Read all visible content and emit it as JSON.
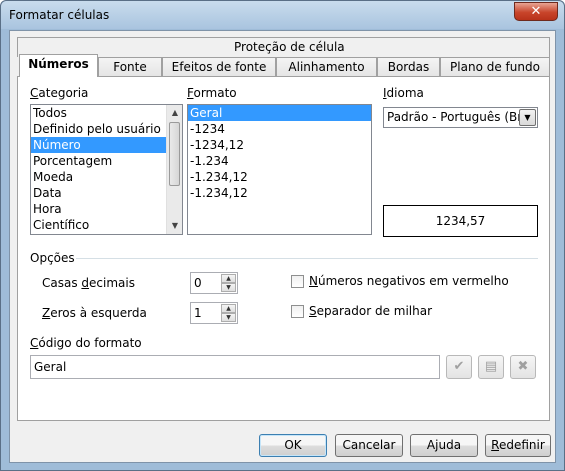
{
  "window": {
    "title": "Formatar células",
    "close_glyph": "✕"
  },
  "tabs_row_top": [
    {
      "label": "Proteção de célula"
    }
  ],
  "tabs_row_bottom": [
    {
      "label": "Números",
      "active": true
    },
    {
      "label": "Fonte"
    },
    {
      "label": "Efeitos de fonte"
    },
    {
      "label": "Alinhamento"
    },
    {
      "label": "Bordas"
    },
    {
      "label": "Plano de fundo"
    }
  ],
  "categoria": {
    "label": "Categoria",
    "items": [
      "Todos",
      "Definido pelo usuário",
      "Número",
      "Porcentagem",
      "Moeda",
      "Data",
      "Hora",
      "Científico"
    ],
    "selected": "Número"
  },
  "formato": {
    "label": "Formato",
    "items": [
      "Geral",
      "-1234",
      "-1234,12",
      "-1.234",
      "-1.234,12",
      "-1.234,12"
    ],
    "selected": "Geral"
  },
  "idioma": {
    "label": "Idioma",
    "value": "Padrão - Português (Brasil)"
  },
  "preview": {
    "value": "1234,57"
  },
  "opcoes": {
    "label": "Opções",
    "casas_decimais_label": "Casas decimais",
    "casas_decimais_value": "0",
    "zeros_label": "Zeros à esquerda",
    "zeros_value": "1",
    "negativos_label": "Números negativos em vermelho",
    "negativos_checked": false,
    "separador_label": "Separador de milhar",
    "separador_checked": false
  },
  "codigo": {
    "label": "Código do formato",
    "value": "Geral"
  },
  "buttons": {
    "ok": "OK",
    "cancel": "Cancelar",
    "help": "Ajuda",
    "reset": "Redefinir"
  },
  "icons": {
    "accept": "check-icon",
    "comment": "comment-icon",
    "delete": "delete-x-icon"
  }
}
